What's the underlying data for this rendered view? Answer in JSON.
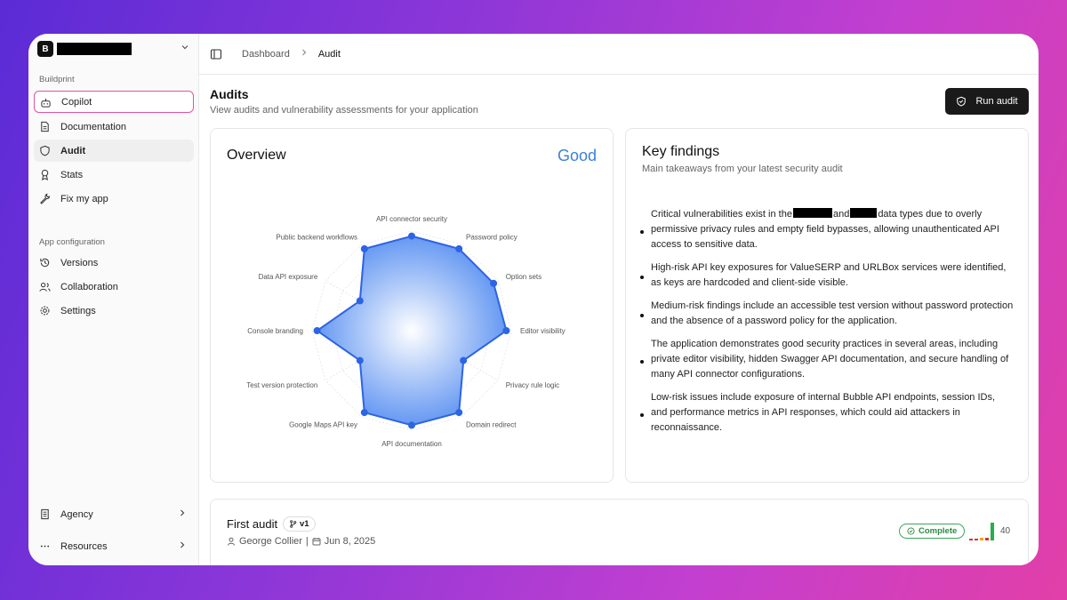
{
  "workspace": {
    "initial": "B"
  },
  "sidebar": {
    "section1_label": "Buildprint",
    "items": [
      {
        "label": "Copilot",
        "icon": "robot-icon"
      },
      {
        "label": "Documentation",
        "icon": "document-icon"
      },
      {
        "label": "Audit",
        "icon": "shield-icon"
      },
      {
        "label": "Stats",
        "icon": "award-icon"
      },
      {
        "label": "Fix my app",
        "icon": "wrench-icon"
      }
    ],
    "section2_label": "App configuration",
    "config_items": [
      {
        "label": "Versions",
        "icon": "history-icon"
      },
      {
        "label": "Collaboration",
        "icon": "users-icon"
      },
      {
        "label": "Settings",
        "icon": "gear-icon"
      }
    ],
    "bottom_items": [
      {
        "label": "Agency",
        "icon": "building-icon"
      },
      {
        "label": "Resources",
        "icon": "more-icon"
      }
    ]
  },
  "breadcrumb": {
    "home": "Dashboard",
    "current": "Audit"
  },
  "header": {
    "title": "Audits",
    "subtitle": "View audits and vulnerability assessments for your application",
    "run_button": "Run audit"
  },
  "overview": {
    "title": "Overview",
    "rating": "Good",
    "accent": "#3d7fd9"
  },
  "chart_data": {
    "type": "radar",
    "axes": [
      "API connector security",
      "Password policy",
      "Option sets",
      "Editor visibility",
      "Privacy rule logic",
      "Domain redirect",
      "API documentation",
      "Google Maps API key",
      "Test version protection",
      "Console branding",
      "Data API exposure",
      "Public backend workflows"
    ],
    "values": [
      95,
      95,
      95,
      95,
      60,
      95,
      95,
      95,
      60,
      95,
      60,
      95
    ],
    "rlim": [
      0,
      100
    ],
    "grid": true,
    "fill_color": "#4a86f0",
    "line_color": "#2c64e3"
  },
  "findings": {
    "title": "Key findings",
    "subtitle": "Main takeaways from your latest security audit",
    "items": [
      {
        "before": "Critical vulnerabilities exist in the",
        "mid": "and",
        "after": "data types due to overly permissive privacy rules and empty field bypasses, allowing unauthenticated API access to sensitive data."
      },
      {
        "text": "High-risk API key exposures for ValueSERP and URLBox services were identified, as keys are hardcoded and client-side visible."
      },
      {
        "text": "Medium-risk findings include an accessible test version without password protection and the absence of a password policy for the application."
      },
      {
        "text": "The application demonstrates good security practices in several areas, including private editor visibility, hidden Swagger API documentation, and secure handling of many API connector configurations."
      },
      {
        "text": "Low-risk issues include exposure of internal Bubble API endpoints, session IDs, and performance metrics in API responses, which could aid attackers in reconnaissance."
      }
    ]
  },
  "audit": {
    "name": "First audit",
    "version": "v1",
    "author": "George Collier",
    "separator": "|",
    "date": "Jun 8, 2025",
    "status": "Complete",
    "status_color": "#2b8a45",
    "score": "40",
    "score_bars": [
      {
        "value": 0.1,
        "color": "#d9342b"
      },
      {
        "value": 0.1,
        "color": "#d9342b"
      },
      {
        "value": 0.15,
        "color": "#f0a020"
      },
      {
        "value": 0.15,
        "color": "#d9342b"
      },
      {
        "value": 1.0,
        "color": "#22b14c"
      }
    ]
  }
}
